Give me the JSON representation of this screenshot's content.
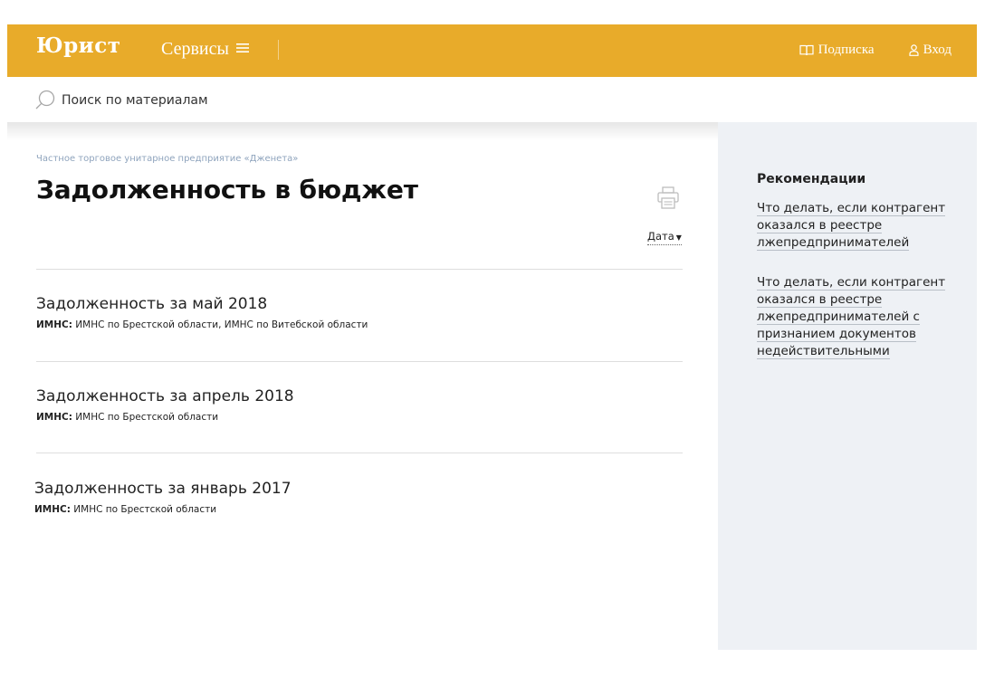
{
  "header": {
    "logo": "Юрист",
    "services_label": "Сервисы",
    "subscription_label": "Подписка",
    "login_label": "Вход"
  },
  "search": {
    "placeholder": "Поиск по материалам"
  },
  "main": {
    "breadcrumb": "Частное торговое унитарное предприятие «Дженета»",
    "title": "Задолженность в бюджет",
    "sort_label": "Дата",
    "items": [
      {
        "title": "Задолженность за май 2018",
        "meta_label": "ИМНС:",
        "meta_value": "ИМНС по Брестской области, ИМНС по Витебской области"
      },
      {
        "title": "Задолженность за апрель 2018",
        "meta_label": "ИМНС:",
        "meta_value": "ИМНС по Брестской области"
      },
      {
        "title": "Задолженность за январь 2017",
        "meta_label": "ИМНС:",
        "meta_value": "ИМНС по Брестской области"
      }
    ]
  },
  "sidebar": {
    "title": "Рекомендации",
    "links": [
      "Что делать, если контрагент оказался в реестре лжепредпринимателей",
      "Что делать, если контрагент оказался в реестре лжепредпринимателей с признанием документов недействительными"
    ]
  },
  "colors": {
    "header_bg": "#e8ab2a",
    "sidebar_bg": "#eef1f5",
    "breadcrumb": "#8fa4bd"
  },
  "icons": {
    "menu": "hamburger-icon",
    "subscription": "book-icon",
    "login": "user-icon",
    "search": "search-icon",
    "print": "printer-icon"
  }
}
